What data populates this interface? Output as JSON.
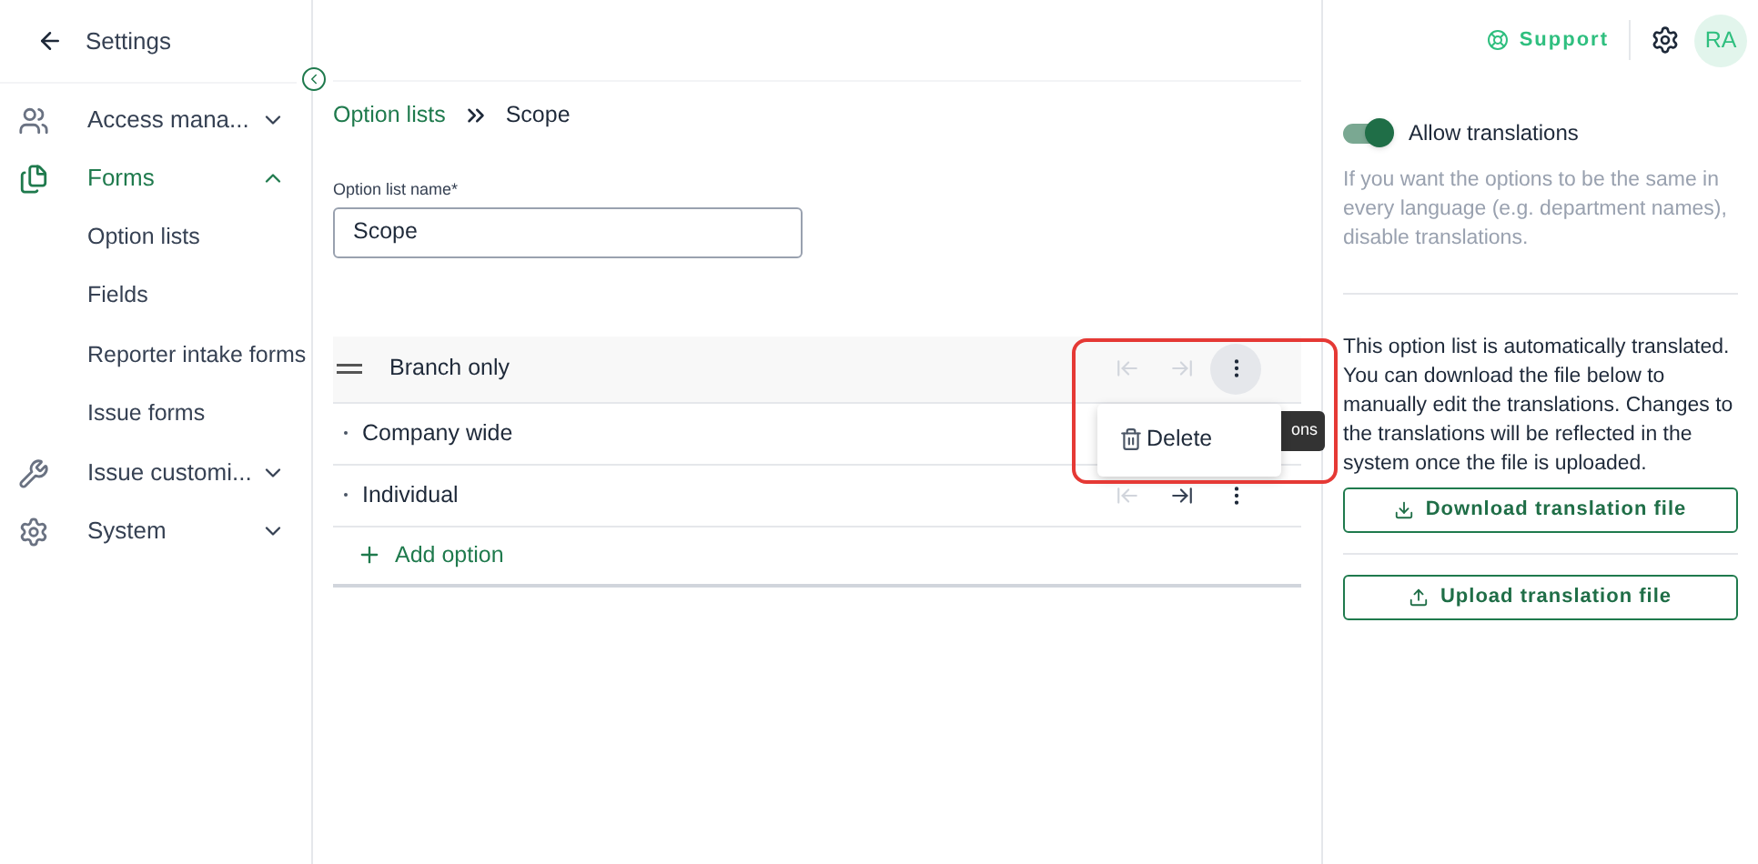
{
  "sidebar": {
    "back_label": "Settings",
    "items": [
      {
        "label": "Access mana...",
        "expanded": false,
        "selected": false
      },
      {
        "label": "Forms",
        "expanded": true,
        "selected": true,
        "children": [
          {
            "label": "Option lists"
          },
          {
            "label": "Fields"
          },
          {
            "label": "Reporter intake forms"
          },
          {
            "label": "Issue forms"
          }
        ]
      },
      {
        "label": "Issue customi...",
        "expanded": false,
        "selected": false
      },
      {
        "label": "System",
        "expanded": false,
        "selected": false
      }
    ]
  },
  "header": {
    "support": "Support",
    "avatar": "RA"
  },
  "breadcrumb": [
    "Option lists",
    "Scope"
  ],
  "name_field": {
    "label": "Option list name*",
    "value": "Scope"
  },
  "options": [
    {
      "kind": "handle",
      "label": "Branch only",
      "outdent_enabled": false,
      "indent_enabled": false,
      "menu_open": true
    },
    {
      "kind": "bullet",
      "label": "Company wide"
    },
    {
      "kind": "bullet",
      "label": "Individual",
      "outdent_enabled": false,
      "indent_enabled": true,
      "menu_open": false
    }
  ],
  "add_option": "Add option",
  "menu": {
    "items": [
      "Delete"
    ]
  },
  "tooltip": "ons",
  "translations": {
    "toggle_label": "Allow translations",
    "on": true,
    "hint": "If you want the options to be the same in every language (e.g. department names), disable translations.",
    "info": "This option list is automatically translated. You can download the file below to manually edit the translations. Changes to the translations will be reflected in the system once the file is uploaded.",
    "download": "Download translation file",
    "upload": "Upload translation file"
  }
}
